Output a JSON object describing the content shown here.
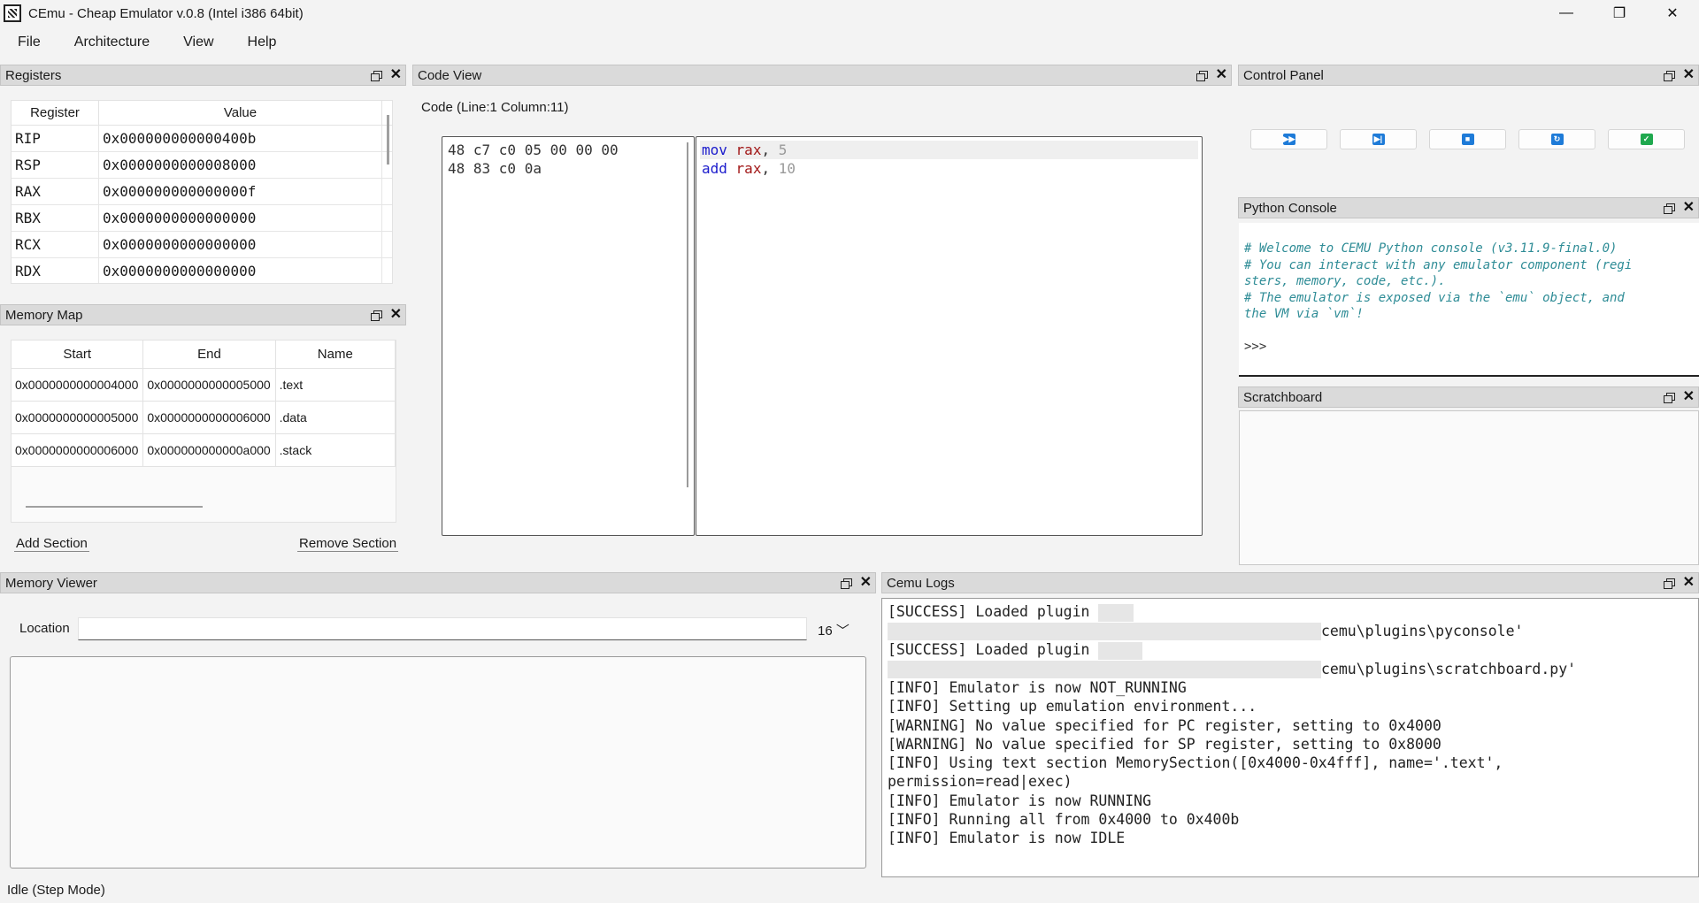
{
  "window": {
    "title": "CEmu - Cheap Emulator v.0.8 (Intel i386 64bit)",
    "minimize": "—",
    "maximize": "❐",
    "close": "✕"
  },
  "menu": [
    "File",
    "Architecture",
    "View",
    "Help"
  ],
  "registers": {
    "title": "Registers",
    "headers": [
      "Register",
      "Value"
    ],
    "rows": [
      {
        "name": "RIP",
        "value": "0x000000000000400b"
      },
      {
        "name": "RSP",
        "value": "0x0000000000008000"
      },
      {
        "name": "RAX",
        "value": "0x000000000000000f"
      },
      {
        "name": "RBX",
        "value": "0x0000000000000000"
      },
      {
        "name": "RCX",
        "value": "0x0000000000000000"
      },
      {
        "name": "RDX",
        "value": "0x0000000000000000"
      }
    ]
  },
  "memory_map": {
    "title": "Memory Map",
    "headers": [
      "Start",
      "End",
      "Name"
    ],
    "rows": [
      {
        "start": "0x0000000000004000",
        "end": "0x0000000000005000",
        "name": ".text"
      },
      {
        "start": "0x0000000000005000",
        "end": "0x0000000000006000",
        "name": ".data"
      },
      {
        "start": "0x0000000000006000",
        "end": "0x000000000000a000",
        "name": ".stack"
      }
    ],
    "add_label": "Add Section",
    "remove_label": "Remove Section"
  },
  "code_view": {
    "title": "Code View",
    "position": "Code (Line:1 Column:11)",
    "hex": [
      "48 c7 c0 05 00 00 00",
      "48 83 c0 0a"
    ],
    "asm": [
      {
        "op": "mov",
        "reg": "rax",
        "imm": "5"
      },
      {
        "op": "add",
        "reg": "rax",
        "imm": "10"
      }
    ]
  },
  "control_panel": {
    "title": "Control Panel",
    "buttons": [
      {
        "name": "run-all",
        "icon": "fast-forward-icon",
        "glyph": "▶▶",
        "color": "#1e7bd8"
      },
      {
        "name": "step",
        "icon": "step-forward-icon",
        "glyph": "▶|",
        "color": "#1e7bd8"
      },
      {
        "name": "stop",
        "icon": "stop-icon",
        "glyph": "■",
        "color": "#1e7bd8"
      },
      {
        "name": "reset",
        "icon": "refresh-icon",
        "glyph": "↻",
        "color": "#1e7bd8"
      },
      {
        "name": "check",
        "icon": "check-icon",
        "glyph": "✓",
        "color": "#1fa84e"
      }
    ]
  },
  "python_console": {
    "title": "Python Console",
    "lines": [
      "# Welcome to CEMU Python console (v3.11.9-final.0)",
      "# You can interact with any emulator component (regi",
      "sters, memory, code, etc.).",
      "# The emulator is exposed via the `emu` object, and",
      "the VM via `vm`!"
    ],
    "prompt": ">>>"
  },
  "scratchboard": {
    "title": "Scratchboard"
  },
  "memory_viewer": {
    "title": "Memory Viewer",
    "location_label": "Location",
    "location_value": "",
    "columns_value": "16"
  },
  "logs": {
    "title": "Cemu Logs",
    "lines": [
      "[SUCCESS] Loaded plugin",
      "cemu\\plugins\\pyconsole'",
      "[SUCCESS] Loaded plugin",
      "cemu\\plugins\\scratchboard.py'",
      "[INFO] Emulator is now NOT_RUNNING",
      "[INFO] Setting up emulation environment...",
      "[WARNING] No value specified for PC register, setting to 0x4000",
      "[WARNING] No value specified for SP register, setting to 0x8000",
      "[INFO] Using text section MemorySection([0x4000-0x4fff], name='.text', permission=read|exec)",
      "[INFO] Emulator is now RUNNING",
      "[INFO] Running all from 0x4000 to 0x400b",
      "[INFO] Emulator is now IDLE"
    ]
  },
  "status": "Idle (Step Mode)"
}
